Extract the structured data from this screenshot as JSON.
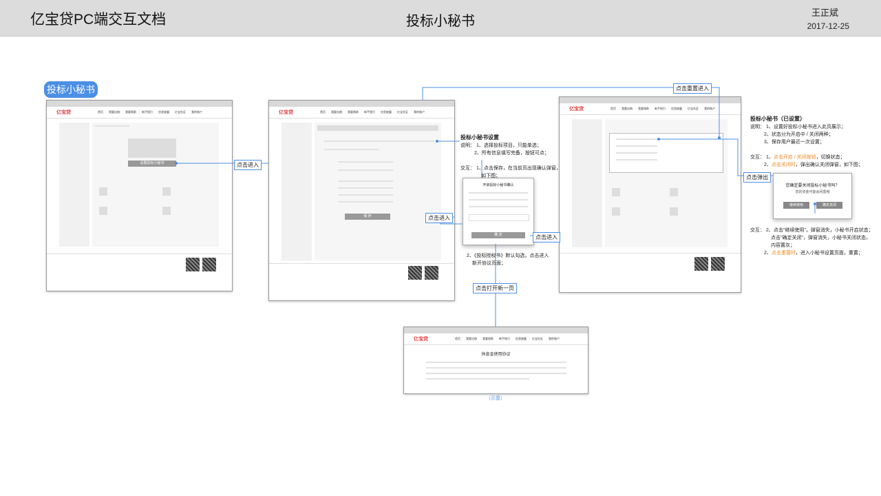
{
  "header": {
    "doc_title": "亿宝贷PC端交互文档",
    "page_title": "投标小秘书",
    "author": "王正斌",
    "date": "2017-12-25"
  },
  "section_tag": "投标小秘书",
  "frames": {
    "logo": "亿宝贷",
    "nav_items": [
      "首页",
      "我要出借",
      "我要借款",
      "新手指引",
      "信息披露",
      "亿宝社区",
      "我的账户"
    ],
    "panel_title": "投标小秘书",
    "setup_button": "设置投标小秘书",
    "save_button": "保 存",
    "agreement_title": "休息金使用协议"
  },
  "dialogs": {
    "confirm_title": "开启投标小秘书确认",
    "confirm_button": "确 定",
    "close_question": "您确定要关闭投标小秘书吗？",
    "close_sub": "您的资金可能会闲置哦",
    "continue_button": "继续使用",
    "confirm_close_button": "确定关闭"
  },
  "callouts": {
    "enter": "点击进入",
    "enter2": "点击进入",
    "enter3": "点击进入",
    "reset": "点击重置进入",
    "popup": "点击弹出",
    "open_page": "点击打开新一页"
  },
  "notes": {
    "setup_title": "投标小秘书设置",
    "setup_l1": "说明：  1、选择投标项目，只能单选；",
    "setup_l2": "2、所有信息填写完备，按钮可点；",
    "setup_l3": "交互：  1、点击保存，在当前页出现确认弹窗，",
    "setup_l4": "如下图；",
    "agree_l1": "2、《投标授权书》默认勾选，点击进入",
    "agree_l2": "新开协议页面；",
    "done_title": "投标小秘书（已设置）",
    "done_l1": "说明：  1、设置好投标小秘书进入此页展示；",
    "done_l2": "2、状态分为开启中 / 关闭两种；",
    "done_l3": "3、保存用户最近一次设置；",
    "done_l4a": "交互：  1、",
    "done_l4b": "点击开启 / 关闭按钮",
    "done_l4c": "，切换状态；",
    "done_l5a": "2、",
    "done_l5b": "点击关闭时",
    "done_l5c": "，弹出确认关闭弹窗，如下图；",
    "done_l6": "交互：  2、点击\"继续使用\"，弹窗消失，小秘书开启状态；",
    "done_l7": "点击\"确定关闭\"，弹窗消失，小秘书关闭状态，",
    "done_l8": "内容置灰；",
    "done_l9a": "2、",
    "done_l9b": "点击重置时",
    "done_l9c": "，进入小秘书设置页面，重置；"
  },
  "caption": "（示意）",
  "colors": {
    "accent": "#4b8fe6",
    "highlight": "#f08a24",
    "brand": "#e23b3b"
  }
}
